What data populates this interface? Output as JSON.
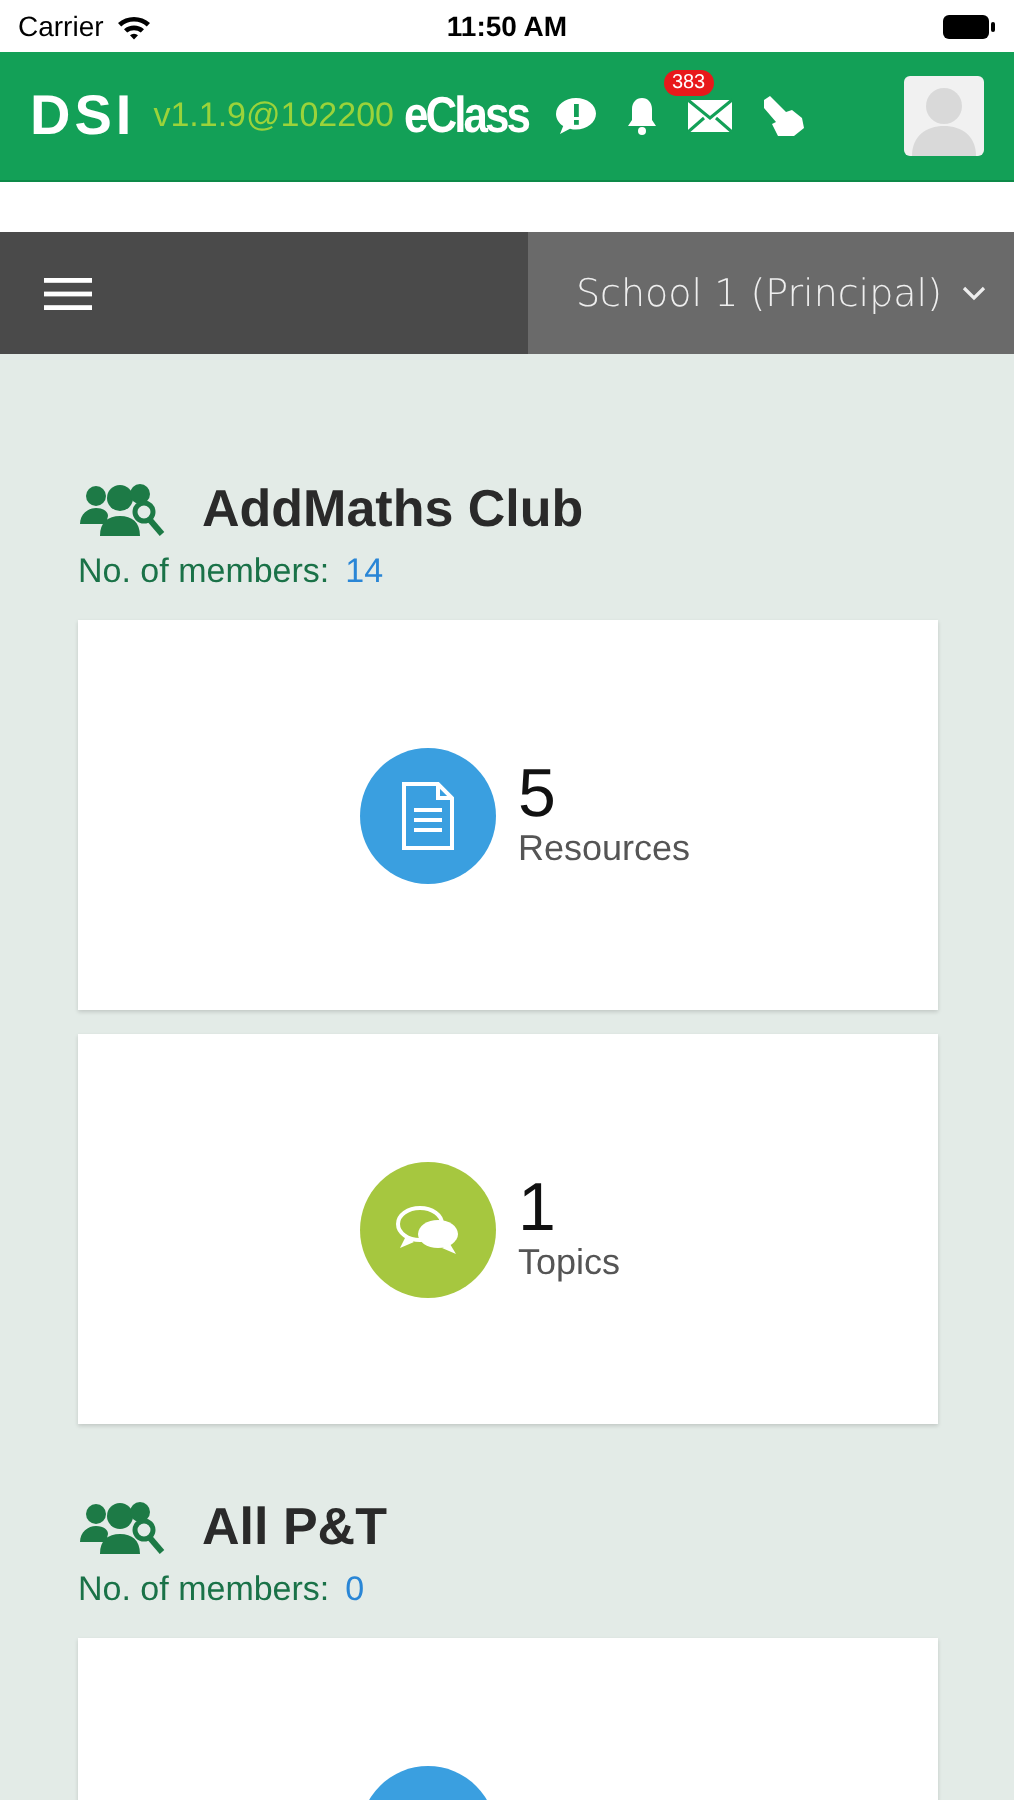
{
  "status_bar": {
    "carrier": "Carrier",
    "time": "11:50 AM"
  },
  "header": {
    "logo": "DSI",
    "version": "v1.1.9@102200",
    "brand": "eClass",
    "mail_badge": "383"
  },
  "nav": {
    "school": "School 1 (Principal)"
  },
  "groups": [
    {
      "name": "AddMaths Club",
      "members_label": "No. of members:",
      "members_count": "14",
      "stats": [
        {
          "kind": "resources",
          "count": "5",
          "label": "Resources"
        },
        {
          "kind": "topics",
          "count": "1",
          "label": "Topics"
        }
      ]
    },
    {
      "name": "All P&T",
      "members_label": "No. of members:",
      "members_count": "0",
      "stats": [
        {
          "kind": "resources"
        }
      ]
    }
  ]
}
